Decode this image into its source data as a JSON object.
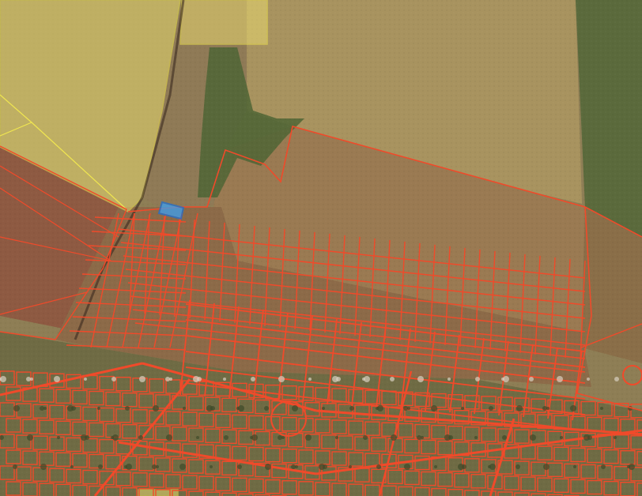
{
  "map": {
    "view": "satellite-imagery-with-cadastral-parcels",
    "layers": [
      {
        "name": "agricultural-fields",
        "color": "#a8935f"
      },
      {
        "name": "cadastral-boundaries",
        "color": "#f04a2a"
      },
      {
        "name": "zoning-overlay",
        "color": "#e9dc4a"
      },
      {
        "name": "selected-parcel",
        "color": "#2f8de0"
      }
    ],
    "colors": {
      "parcel_outline": "#f04a2a",
      "zone_outline": "#f0e650",
      "zone_fill": "#e8d870",
      "selected_outline": "#1f6fd0",
      "selected_fill": "#3da0f0",
      "field_brown": "#9c7a50",
      "field_tan": "#b09a66",
      "field_green": "#56633a",
      "village": "#7a6e48"
    }
  }
}
